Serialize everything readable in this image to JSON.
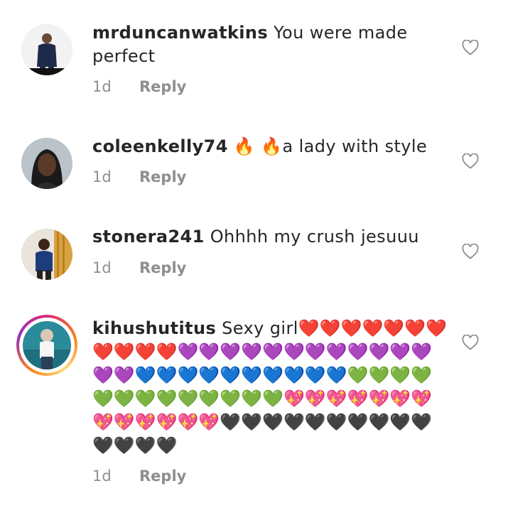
{
  "comments": [
    {
      "username": "mrduncanwatkins",
      "text": "You were made perfect",
      "time": "1d",
      "reply_label": "Reply"
    },
    {
      "username": "coleenkelly74",
      "text": "🔥 🔥a lady with style",
      "time": "1d",
      "reply_label": "Reply"
    },
    {
      "username": "stonera241",
      "text": "Ohhhh my crush jesuuu",
      "time": "1d",
      "reply_label": "Reply"
    },
    {
      "username": "kihushutitus",
      "text": "Sexy girl",
      "emoji": "❤️❤️❤️❤️❤️❤️❤️❤️❤️❤️❤️💜💜💜💜💜💜💜💜💜💜💜💜💜💜💙💙💙💙💙💙💙💙💙💙💚💚💚💚💚💚💚💚💚💚💚💚💚💖💖💖💖💖💖💖💖💖💖💖💖💖🖤🖤🖤🖤🖤🖤🖤🖤🖤🖤🖤🖤🖤🖤",
      "time": "1d",
      "reply_label": "Reply",
      "has_story_ring": true
    }
  ],
  "icons": {
    "like": "heart-outline-icon"
  },
  "colors": {
    "text": "#262626",
    "meta": "#8e8e8e",
    "like_outline": "#8e8e8e"
  }
}
